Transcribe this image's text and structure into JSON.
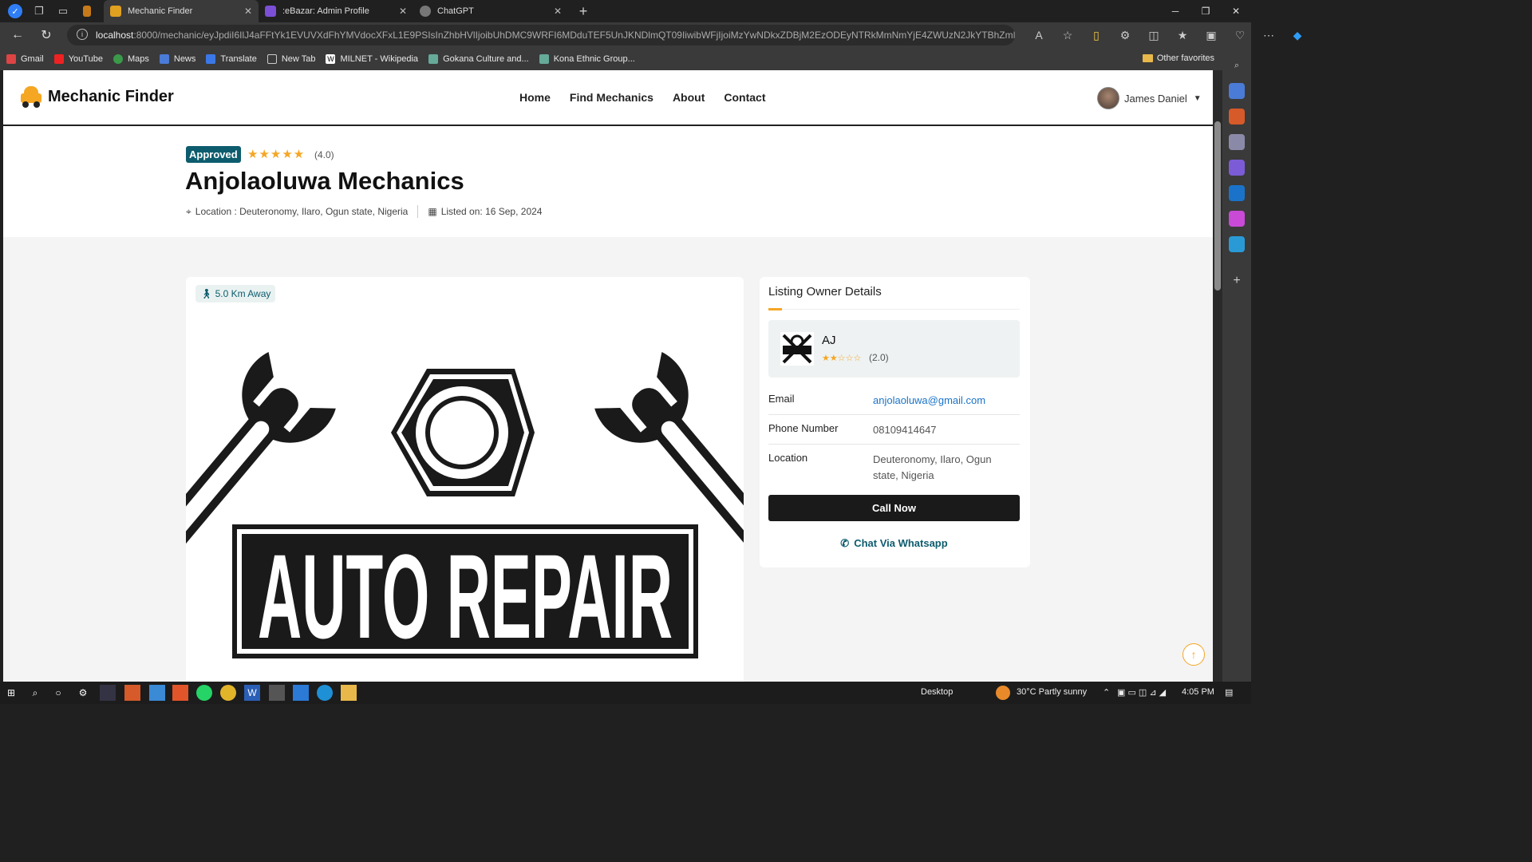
{
  "browser": {
    "tabs": [
      {
        "label": "Mechanic Finder",
        "active": true
      },
      {
        "label": ":eBazar: Admin Profile",
        "active": false
      },
      {
        "label": "ChatGPT",
        "active": false
      }
    ],
    "url_host": "localhost",
    "url_rest": ":8000/mechanic/eyJpdiI6IlJ4aFFtYk1EVUVXdFhYMVdocXFxL1E9PSIsInZhbHVlIjoibUhDMC9WRFI6MDduTEF5UnJKNDlmQT09IiwibWFjIjoiMzYwNDkxZDBjM2EzODEyNTRkMmNmYjE4ZWUzN2JkYTBhZmM3Z...",
    "bookmarks": [
      "Gmail",
      "YouTube",
      "Maps",
      "News",
      "Translate",
      "New Tab",
      "MILNET - Wikipedia",
      "Gokana Culture and...",
      "Kona Ethnic Group..."
    ],
    "other_favorites": "Other favorites"
  },
  "site": {
    "logo_text": "Mechanic Finder",
    "nav": [
      "Home",
      "Find Mechanics",
      "About",
      "Contact"
    ],
    "user_name": "James Daniel"
  },
  "listing": {
    "status": "Approved",
    "stars": "★★★★★",
    "rating_text": "(4.0)",
    "rating": 4.0,
    "title": "Anjolaoluwa Mechanics",
    "location": "Location : Deuteronomy, Ilaro, Ogun state, Nigeria",
    "listed_on": "Listed on: 16 Sep, 2024",
    "distance": "5.0 Km Away",
    "image_text": "AUTO REPAIR"
  },
  "owner": {
    "heading": "Listing Owner Details",
    "name": "AJ",
    "stars": "★★☆☆☆",
    "rating_text": "(2.0)",
    "rating": 2.0,
    "email_label": "Email",
    "email": "anjolaoluwa@gmail.com",
    "phone_label": "Phone Number",
    "phone": "08109414647",
    "location_label": "Location",
    "location": "Deuteronomy, Ilaro, Ogun state, Nigeria",
    "call_button": "Call Now",
    "whatsapp_button": "Chat Via Whatsapp"
  },
  "taskbar": {
    "desktop": "Desktop",
    "weather": "30°C  Partly sunny",
    "time": "4:05 PM"
  },
  "colors": {
    "accent": "#0d5c6e",
    "star": "#f5a623",
    "link": "#1a73c8"
  }
}
